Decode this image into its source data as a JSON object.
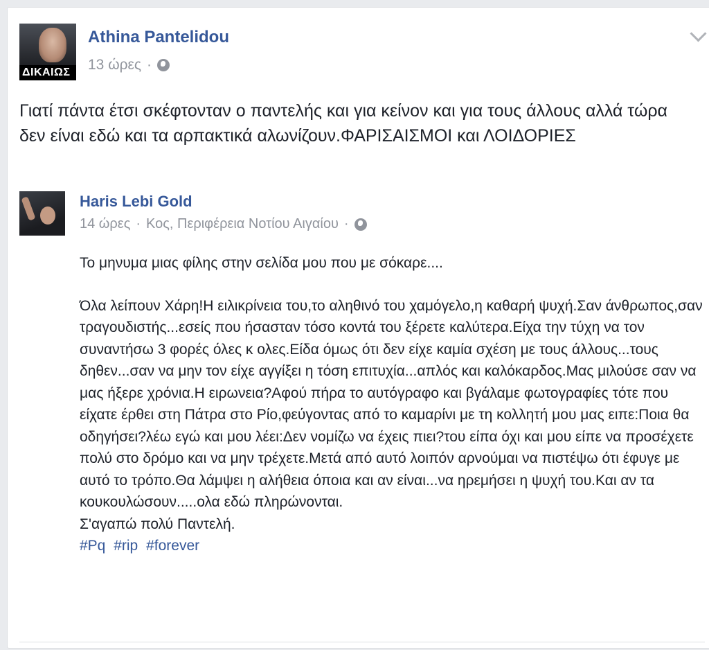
{
  "post": {
    "author": "Athina Pantelidou",
    "time": "13 ώρες",
    "separator": "·",
    "avatar_badge": "ΔΙΚΑΙΩΣ",
    "text": "Γιατί πάντα έτσι σκέφτονταν ο παντελής και για κείνον και για τους άλλους αλλά τώρα δεν είναι εδώ και τα αρπακτικά αλωνίζουν.ΦΑΡΙΣΑΙΣΜΟΙ και ΛΟΙΔΟΡΙΕΣ"
  },
  "shared": {
    "author": "Haris Lebi Gold",
    "time": "14 ώρες",
    "separator": "·",
    "location": "Κος, Περιφέρεια Νοτίου Αιγαίου",
    "paragraph1": "Το μηνυμα μιας φίλης στην σελίδα μου που με σόκαρε....",
    "paragraph2": "Όλα λείπουν Χάρη!Η ειλικρίνεια του,το αληθινό του χαμόγελο,η καθαρή ψυχή.Σαν άνθρωπος,σαν τραγουδιστής...εσείς που ήσασταν τόσο κοντά του ξέρετε καλύτερα.Είχα την τύχη να τον συναντήσω 3 φορές όλες κ ολες.Είδα όμως ότι δεν είχε καμία σχέση με τους άλλους...τους δηθεν...σαν να μην τον είχε αγγίξει η τόση επιτυχία...απλός και καλόκαρδος.Μας μιλούσε σαν να μας ήξερε χρόνια.Η ειρωνεια?Αφού πήρα το αυτόγραφο και βγάλαμε φωτογραφίες τότε που είχατε έρθει στη Πάτρα στο Ρίο,φεύγοντας από το καμαρίνι με τη κολλητή μου μας ειπε:Ποια θα οδηγήσει?λέω εγώ και μου λέει:Δεν νομίζω να έχεις πιει?του είπα όχι και μου είπε να προσέχετε πολύ στο δρόμο και να μην τρέχετε.Μετά από αυτό λοιπόν αρνούμαι να πιστέψω ότι έφυγε με αυτό το τρόπο.Θα λάμψει η αλήθεια όποια και αν είναι...να ηρεμήσει η ψυχή του.Και αν τα κουκουλώσουν.....ολα εδώ πληρώνονται.",
    "closing": "Σ'αγαπώ πολύ Παντελή.",
    "hashtags": [
      "#Pq",
      "#rip",
      "#forever"
    ]
  },
  "icons": {
    "privacy": "globe-icon",
    "menu": "chevron-down-icon"
  },
  "colors": {
    "link": "#365899",
    "meta": "#90949c",
    "text": "#1d2129"
  }
}
